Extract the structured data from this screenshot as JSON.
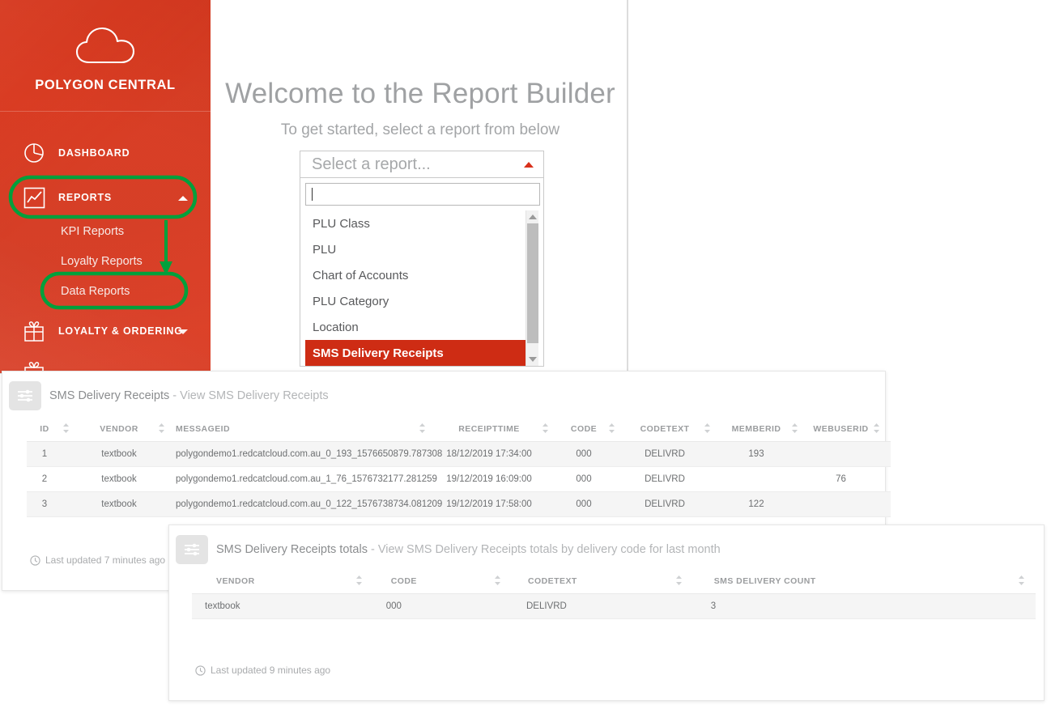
{
  "brand": {
    "name": "POLYGON CENTRAL",
    "logo_icon": "cloud-icon",
    "accent": "#e03a1e"
  },
  "sidebar": {
    "items": [
      {
        "label": "DASHBOARD",
        "icon": "pie-chart-icon",
        "caret": ""
      },
      {
        "label": "REPORTS",
        "icon": "line-chart-icon",
        "caret": "up"
      },
      {
        "label": "LOYALTY & ORDERING",
        "icon": "gift-icon",
        "caret": "down"
      }
    ],
    "sub_items": [
      {
        "label": "KPI Reports"
      },
      {
        "label": "Loyalty Reports"
      },
      {
        "label": "Data Reports"
      }
    ]
  },
  "annotations": {
    "color": "#00a03c"
  },
  "main": {
    "title": "Welcome to the Report Builder",
    "subtitle": "To get started, select a report from below",
    "select": {
      "placeholder": "Select a report...",
      "search_value": "",
      "options": [
        "PLU Class",
        "PLU",
        "Chart of Accounts",
        "PLU Category",
        "Location",
        "SMS Delivery Receipts"
      ],
      "selected": "SMS Delivery Receipts",
      "selected_color": "#ce2c14"
    }
  },
  "panel_1": {
    "icon": "sliders-icon",
    "title": "SMS Delivery Receipts",
    "subtitle": "- View SMS Delivery Receipts",
    "columns": [
      "ID",
      "VENDOR",
      "MESSAGEID",
      "RECEIPTTIME",
      "CODE",
      "CODETEXT",
      "MEMBERID",
      "WEBUSERID"
    ],
    "rows": [
      [
        "1",
        "textbook",
        "polygondemo1.redcatcloud.com.au_0_193_1576650879.787308",
        "18/12/2019 17:34:00",
        "000",
        "DELIVRD",
        "193",
        ""
      ],
      [
        "2",
        "textbook",
        "polygondemo1.redcatcloud.com.au_1_76_1576732177.281259",
        "19/12/2019 16:09:00",
        "000",
        "DELIVRD",
        "",
        "76"
      ],
      [
        "3",
        "textbook",
        "polygondemo1.redcatcloud.com.au_0_122_1576738734.081209",
        "19/12/2019 17:58:00",
        "000",
        "DELIVRD",
        "122",
        ""
      ]
    ],
    "last_updated": "Last updated 7 minutes ago"
  },
  "panel_2": {
    "icon": "sliders-icon",
    "title": "SMS Delivery Receipts totals",
    "subtitle": "- View SMS Delivery Receipts totals by delivery code for last month",
    "columns": [
      "VENDOR",
      "CODE",
      "CODETEXT",
      "SMS DELIVERY COUNT"
    ],
    "rows": [
      [
        "textbook",
        "000",
        "DELIVRD",
        "3"
      ]
    ],
    "last_updated": "Last updated 9 minutes ago"
  }
}
